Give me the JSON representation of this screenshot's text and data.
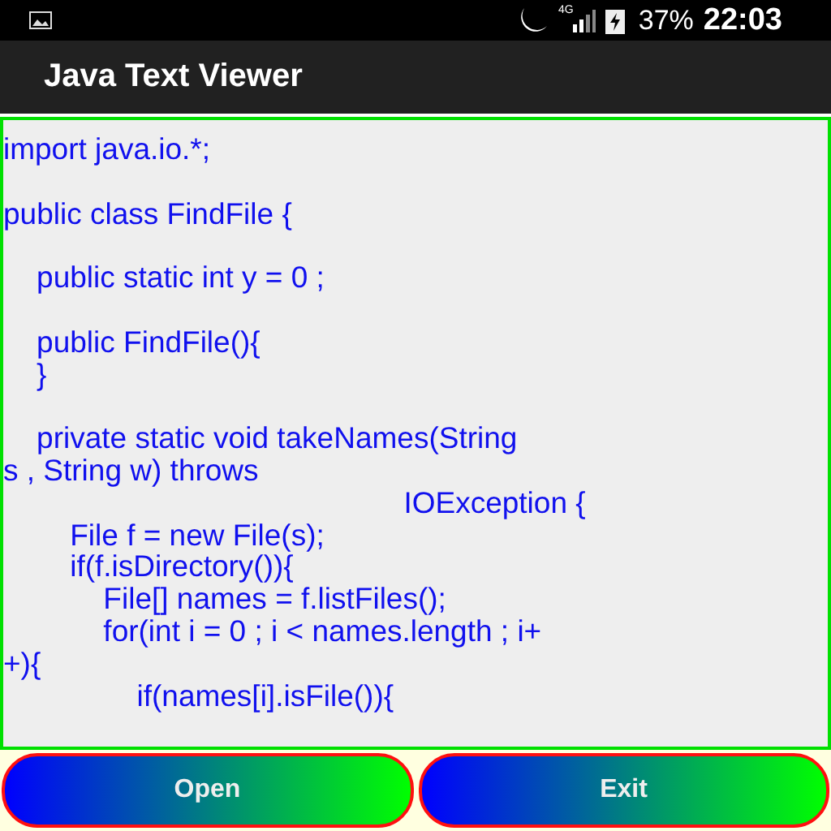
{
  "status_bar": {
    "battery": "37%",
    "time": "22:03",
    "network": "4G"
  },
  "app_bar": {
    "title": "Java Text Viewer"
  },
  "code_blocks": [
    [
      "import java.io.*;"
    ],
    [
      "public class FindFile {"
    ],
    [
      "    public static int y = 0 ;"
    ],
    [
      "    public FindFile(){",
      "    }"
    ],
    [
      "    private static void takeNames(String",
      "s , String w) throws",
      "                                                IOException {",
      "        File f = new File(s);",
      "        if(f.isDirectory()){",
      "            File[] names = f.listFiles();",
      "            for(int i = 0 ; i < names.length ; i+",
      "+){",
      "                if(names[i].isFile()){"
    ]
  ],
  "buttons": [
    {
      "label": "Open"
    },
    {
      "label": "Exit"
    }
  ]
}
